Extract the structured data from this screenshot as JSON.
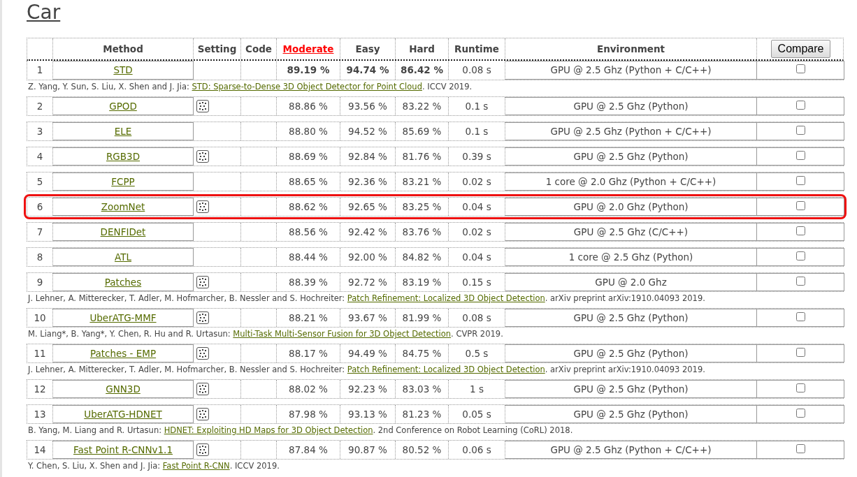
{
  "title": "Car",
  "table": {
    "columns": [
      {
        "label": "Method",
        "sorted": false
      },
      {
        "label": "Setting",
        "sorted": false
      },
      {
        "label": "Code",
        "sorted": false
      },
      {
        "label": "Moderate",
        "sorted": true
      },
      {
        "label": "Easy",
        "sorted": false
      },
      {
        "label": "Hard",
        "sorted": false
      },
      {
        "label": "Runtime",
        "sorted": false
      },
      {
        "label": "Environment",
        "sorted": false
      }
    ],
    "compare_button": "Compare",
    "rows": [
      {
        "rank": "1",
        "method": "STD",
        "setting_icon": false,
        "moderate": "89.19 %",
        "easy": "94.74 %",
        "hard": "86.42 %",
        "runtime": "0.08 s",
        "environment": "GPU @ 2.5 Ghz (Python + C/C++)",
        "checked": false,
        "bold": true,
        "highlighted": false,
        "citation": {
          "authors": "Z. Yang, Y. Sun, S. Liu, X. Shen and J. Jia:",
          "link": "STD: Sparse-to-Dense 3D Object Detector for Point Cloud",
          "venue": ". ICCV 2019."
        }
      },
      {
        "rank": "2",
        "method": "GPOD",
        "setting_icon": true,
        "moderate": "88.86 %",
        "easy": "93.56 %",
        "hard": "83.22 %",
        "runtime": "0.1 s",
        "environment": "GPU @ 2.5 Ghz (Python)",
        "checked": false,
        "bold": false,
        "highlighted": false
      },
      {
        "rank": "3",
        "method": "ELE",
        "setting_icon": false,
        "moderate": "88.80 %",
        "easy": "94.52 %",
        "hard": "85.69 %",
        "runtime": "0.1 s",
        "environment": "GPU @ 2.5 Ghz (Python + C/C++)",
        "checked": false,
        "bold": false,
        "highlighted": false
      },
      {
        "rank": "4",
        "method": "RGB3D",
        "setting_icon": true,
        "moderate": "88.69 %",
        "easy": "92.84 %",
        "hard": "81.76 %",
        "runtime": "0.39 s",
        "environment": "GPU @ 2.5 Ghz (Python)",
        "checked": false,
        "bold": false,
        "highlighted": false
      },
      {
        "rank": "5",
        "method": "FCPP",
        "setting_icon": false,
        "moderate": "88.65 %",
        "easy": "92.36 %",
        "hard": "83.21 %",
        "runtime": "0.02 s",
        "environment": "1 core @ 2.0 Ghz (Python + C/C++)",
        "checked": false,
        "bold": false,
        "highlighted": false
      },
      {
        "rank": "6",
        "method": "ZoomNet",
        "setting_icon": true,
        "moderate": "88.62 %",
        "easy": "92.65 %",
        "hard": "83.25 %",
        "runtime": "0.04 s",
        "environment": "GPU @ 2.0 Ghz (Python)",
        "checked": false,
        "bold": false,
        "highlighted": true
      },
      {
        "rank": "7",
        "method": "DENFIDet",
        "setting_icon": false,
        "moderate": "88.56 %",
        "easy": "92.42 %",
        "hard": "83.76 %",
        "runtime": "0.02 s",
        "environment": "GPU @ 2.5 Ghz (C/C++)",
        "checked": false,
        "bold": false,
        "highlighted": false
      },
      {
        "rank": "8",
        "method": "ATL",
        "setting_icon": false,
        "moderate": "88.44 %",
        "easy": "92.00 %",
        "hard": "84.82 %",
        "runtime": "0.04 s",
        "environment": "1 core @ 2.5 Ghz (Python)",
        "checked": false,
        "bold": false,
        "highlighted": false
      },
      {
        "rank": "9",
        "method": "Patches",
        "setting_icon": true,
        "moderate": "88.39 %",
        "easy": "92.72 %",
        "hard": "83.19 %",
        "runtime": "0.15 s",
        "environment": "GPU @ 2.0 Ghz",
        "checked": false,
        "bold": false,
        "highlighted": false,
        "citation": {
          "authors": "J. Lehner, A. Mitterecker, T. Adler, M. Hofmarcher, B. Nessler and S. Hochreiter:",
          "link": "Patch Refinement: Localized 3D Object Detection",
          "venue": ". arXiv preprint arXiv:1910.04093 2019."
        }
      },
      {
        "rank": "10",
        "method": "UberATG-MMF",
        "setting_icon": true,
        "moderate": "88.21 %",
        "easy": "93.67 %",
        "hard": "81.99 %",
        "runtime": "0.08 s",
        "environment": "GPU @ 2.5 Ghz (Python)",
        "checked": false,
        "bold": false,
        "highlighted": false,
        "citation": {
          "authors": "M. Liang*, B. Yang*, Y. Chen, R. Hu and R. Urtasun:",
          "link": "Multi-Task Multi-Sensor Fusion for 3D Object Detection",
          "venue": ". CVPR 2019."
        }
      },
      {
        "rank": "11",
        "method": "Patches - EMP",
        "setting_icon": true,
        "moderate": "88.17 %",
        "easy": "94.49 %",
        "hard": "84.75 %",
        "runtime": "0.5 s",
        "environment": "GPU @ 2.5 Ghz (Python)",
        "checked": false,
        "bold": false,
        "highlighted": false,
        "citation": {
          "authors": "J. Lehner, A. Mitterecker, T. Adler, M. Hofmarcher, B. Nessler and S. Hochreiter:",
          "link": "Patch Refinement: Localized 3D Object Detection",
          "venue": ". arXiv preprint arXiv:1910.04093 2019."
        }
      },
      {
        "rank": "12",
        "method": "GNN3D",
        "setting_icon": true,
        "moderate": "88.02 %",
        "easy": "92.23 %",
        "hard": "83.03 %",
        "runtime": "1 s",
        "environment": "GPU @ 2.5 Ghz (Python)",
        "checked": false,
        "bold": false,
        "highlighted": false
      },
      {
        "rank": "13",
        "method": "UberATG-HDNET",
        "setting_icon": true,
        "moderate": "87.98 %",
        "easy": "93.13 %",
        "hard": "81.23 %",
        "runtime": "0.05 s",
        "environment": "GPU @ 2.5 Ghz (Python)",
        "checked": false,
        "bold": false,
        "highlighted": false,
        "citation": {
          "authors": "B. Yang, M. Liang and R. Urtasun:",
          "link": "HDNET: Exploiting HD Maps for 3D Object Detection",
          "venue": ". 2nd Conference on Robot Learning (CoRL) 2018."
        }
      },
      {
        "rank": "14",
        "method": "Fast Point R-CNNv1.1",
        "setting_icon": true,
        "moderate": "87.84 %",
        "easy": "90.87 %",
        "hard": "80.52 %",
        "runtime": "0.06 s",
        "environment": "GPU @ 2.5 Ghz (Python + C/C++)",
        "checked": false,
        "bold": false,
        "highlighted": false,
        "citation": {
          "authors": "Y. Chen, S. Liu, X. Shen and J. Jia:",
          "link": "Fast Point R-CNN",
          "venue": ". ICCV 2019."
        }
      }
    ]
  }
}
